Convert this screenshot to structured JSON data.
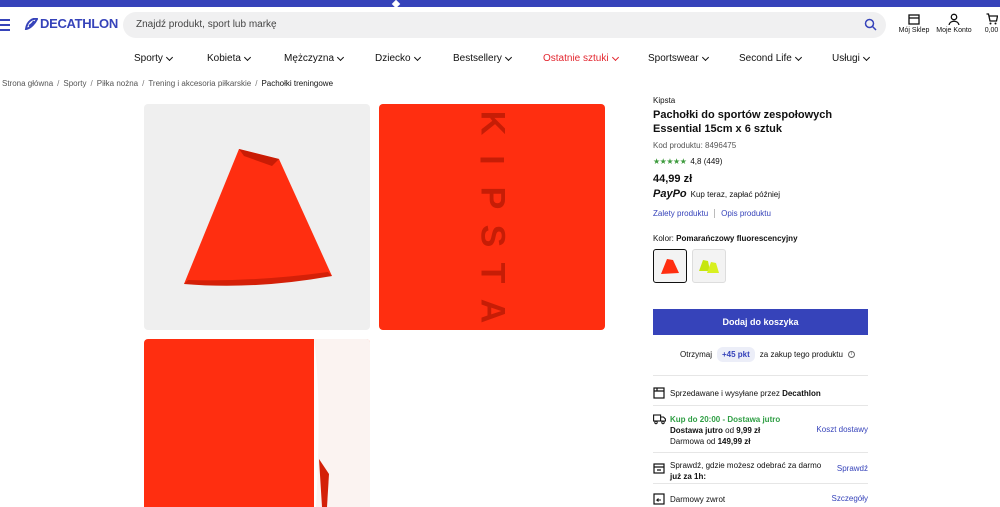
{
  "brand_colors": {
    "primary": "#3643ba",
    "sale_red": "#e3262f",
    "stars_green": "#3e9b3e",
    "delivery_green": "#2f9e44",
    "product_orange": "#ff2e10"
  },
  "header": {
    "logo_text": "DECATHLON",
    "search_placeholder": "Znajdź produkt, sport lub markę",
    "icons": [
      {
        "name": "store-icon",
        "label": "Mój Sklep"
      },
      {
        "name": "account-icon",
        "label": "Moje Konto"
      },
      {
        "name": "cart-icon",
        "label": "0,00"
      }
    ]
  },
  "nav": {
    "items": [
      {
        "label": "Sporty"
      },
      {
        "label": "Kobieta"
      },
      {
        "label": "Mężczyzna"
      },
      {
        "label": "Dziecko"
      },
      {
        "label": "Bestsellery"
      },
      {
        "label": "Ostatnie sztuki",
        "highlight": true
      },
      {
        "label": "Sportswear"
      },
      {
        "label": "Second Life"
      },
      {
        "label": "Usługi"
      }
    ]
  },
  "breadcrumb": [
    "Strona główna",
    "Sporty",
    "Piłka nożna",
    "Trening i akcesoria piłkarskie",
    "Pachołki treningowe"
  ],
  "gallery": {
    "tile2_text": [
      "K",
      "I",
      "P",
      "S",
      "T",
      "A"
    ]
  },
  "product": {
    "brand": "Kipsta",
    "title": "Pachołki do sportów zespołowych Essential 15cm x 6 sztuk",
    "code": "Kod produktu: 8496475",
    "stars": "★★★★★",
    "rating": "4,8",
    "reviews": "(449)",
    "price": "44,99 zł",
    "paypo_logo": "PayPo",
    "paypo_text": "Kup teraz, zapłać później",
    "link_advantages": "Zalety produktu",
    "link_description": "Opis produktu",
    "color_label": "Kolor:",
    "color_value": "Pomarańczowy fluorescencyjny",
    "add_to_cart": "Dodaj do koszyka",
    "points_prefix": "Otrzymaj",
    "points_value": "+45 pkt",
    "points_suffix": "za zakup tego produktu"
  },
  "services": {
    "sold_by_prefix": "Sprzedawane i wysyłane przez",
    "sold_by_name": "Decathlon",
    "delivery_headline": "Kup do 20:00 - Dostawa jutro",
    "delivery_line1_bold": "Dostawa jutro",
    "delivery_line1_rest": " od ",
    "delivery_line1_price": "9,99 zł",
    "delivery_line2_rest": "Darmowa od ",
    "delivery_line2_price": "149,99 zł",
    "delivery_link": "Koszt dostawy",
    "pickup_line1": "Sprawdź, gdzie możesz odebrać za darmo",
    "pickup_line2": "już za 1h:",
    "pickup_link": "Sprawdź",
    "return_text": "Darmowy zwrot",
    "return_link": "Szczegóły"
  }
}
